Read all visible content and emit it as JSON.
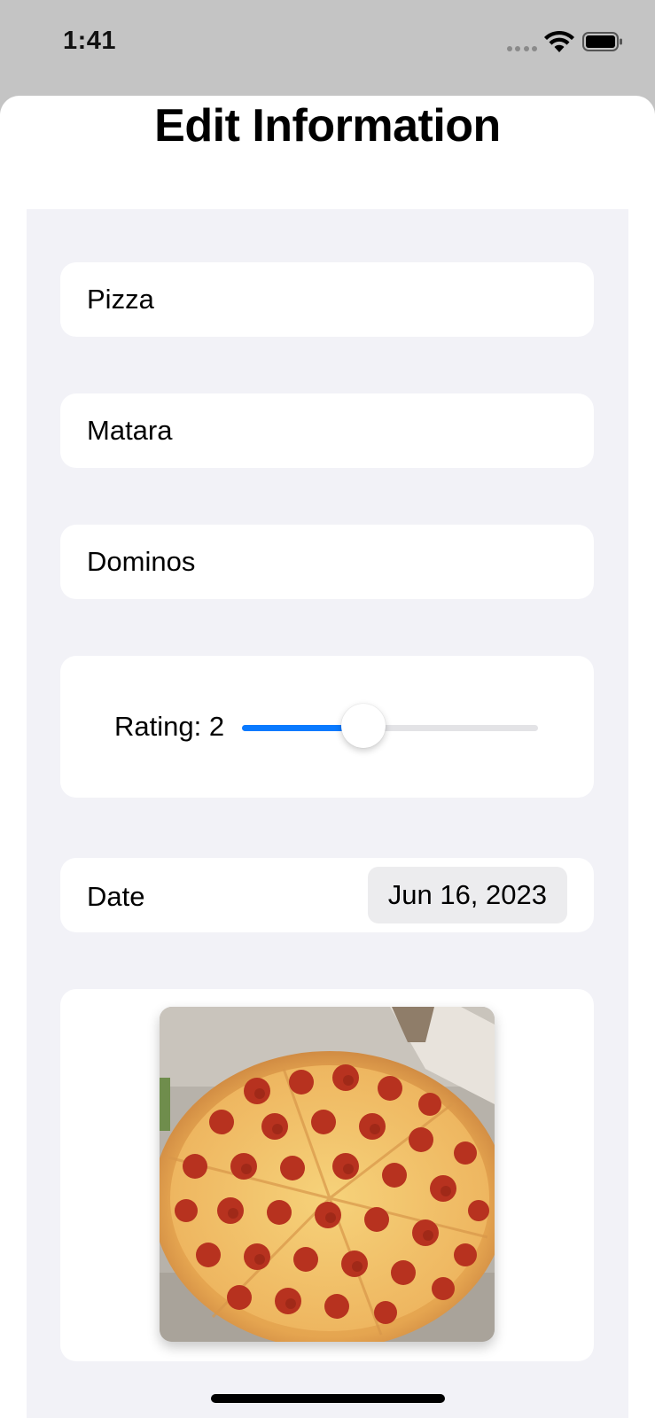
{
  "status_bar": {
    "time": "1:41"
  },
  "sheet": {
    "title": "Edit Information"
  },
  "form": {
    "food_name": "Pizza",
    "location": "Matara",
    "restaurant": "Dominos",
    "rating": {
      "label": "Rating: 2",
      "slider_fraction": 0.41
    },
    "date": {
      "label": "Date",
      "value": "Jun 16, 2023"
    },
    "photo": {
      "icon": "pizza-photo"
    }
  },
  "colors": {
    "accent": "#0a7aff",
    "form_background": "#f2f2f7",
    "card_background": "#ffffff",
    "date_pill": "#ececee"
  }
}
